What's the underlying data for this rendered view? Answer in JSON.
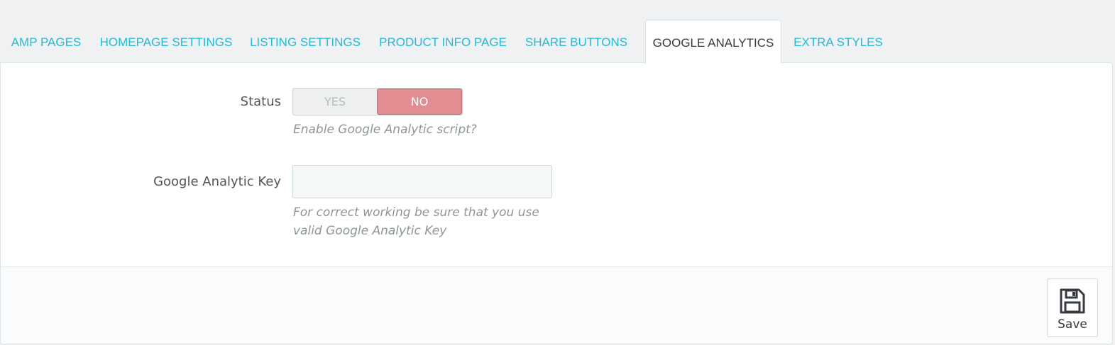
{
  "tabs": [
    {
      "label": "AMP PAGES",
      "active": false
    },
    {
      "label": "HOMEPAGE SETTINGS",
      "active": false
    },
    {
      "label": "LISTING SETTINGS",
      "active": false
    },
    {
      "label": "PRODUCT INFO PAGE",
      "active": false
    },
    {
      "label": "SHARE BUTTONS",
      "active": false
    },
    {
      "label": "GOOGLE ANALYTICS",
      "active": true
    },
    {
      "label": "EXTRA STYLES",
      "active": false
    }
  ],
  "form": {
    "status": {
      "label": "Status",
      "yes_label": "YES",
      "no_label": "NO",
      "selected": "NO",
      "hint": "Enable Google Analytic script?"
    },
    "key": {
      "label": "Google Analytic Key",
      "value": "",
      "placeholder": "",
      "hint": "For correct working be sure that you use valid Google Analytic Key"
    }
  },
  "footer": {
    "save_label": "Save",
    "save_icon": "floppy-disk-icon"
  },
  "colors": {
    "tab_link": "#25b9d7",
    "tab_active_text": "#363a41",
    "switch_no_bg": "#e28d92",
    "background": "#eff1f2"
  }
}
